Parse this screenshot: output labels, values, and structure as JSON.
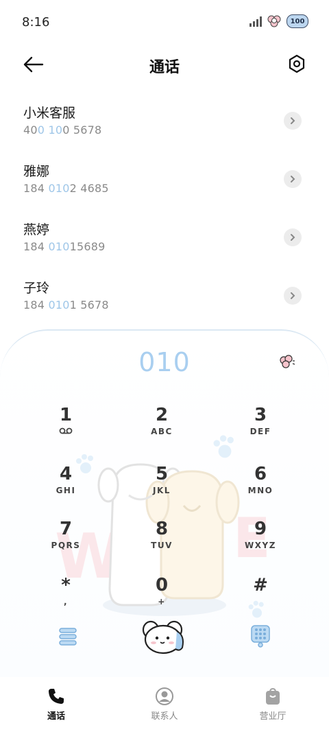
{
  "status_bar": {
    "time": "8:16",
    "battery_label": "100"
  },
  "header": {
    "title": "通话"
  },
  "calls": [
    {
      "name": "小米客服",
      "number_pre": "40",
      "number_hl1": "0",
      "number_mid": " ",
      "number_hl2": "10",
      "number_post": "0 5678"
    },
    {
      "name": "雅娜",
      "number_pre": "184 ",
      "number_hl1": "010",
      "number_mid": "",
      "number_hl2": "",
      "number_post": "2 4685"
    },
    {
      "name": "燕婷",
      "number_pre": "184 ",
      "number_hl1": "010",
      "number_mid": "",
      "number_hl2": "",
      "number_post": "15689"
    },
    {
      "name": "子玲",
      "number_pre": "184 ",
      "number_hl1": "010",
      "number_mid": "",
      "number_hl2": "",
      "number_post": "1 5678"
    }
  ],
  "dialer": {
    "input_value": "010",
    "keys": [
      {
        "digit": "1",
        "letters": ""
      },
      {
        "digit": "2",
        "letters": "ABC"
      },
      {
        "digit": "3",
        "letters": "DEF"
      },
      {
        "digit": "4",
        "letters": "GHI"
      },
      {
        "digit": "5",
        "letters": "JKL"
      },
      {
        "digit": "6",
        "letters": "MNO"
      },
      {
        "digit": "7",
        "letters": "PQRS"
      },
      {
        "digit": "8",
        "letters": "TUV"
      },
      {
        "digit": "9",
        "letters": "WXYZ"
      },
      {
        "digit": "*",
        "letters": ","
      },
      {
        "digit": "0",
        "letters": "+"
      },
      {
        "digit": "#",
        "letters": ""
      }
    ]
  },
  "bottom_nav": [
    {
      "label": "通话",
      "icon": "phone-icon",
      "active": true
    },
    {
      "label": "联系人",
      "icon": "person-icon",
      "active": false
    },
    {
      "label": "营业厅",
      "icon": "bag-icon",
      "active": false
    }
  ],
  "colors": {
    "accent": "#a9cff0",
    "highlight_number": "#9ec6e8"
  }
}
